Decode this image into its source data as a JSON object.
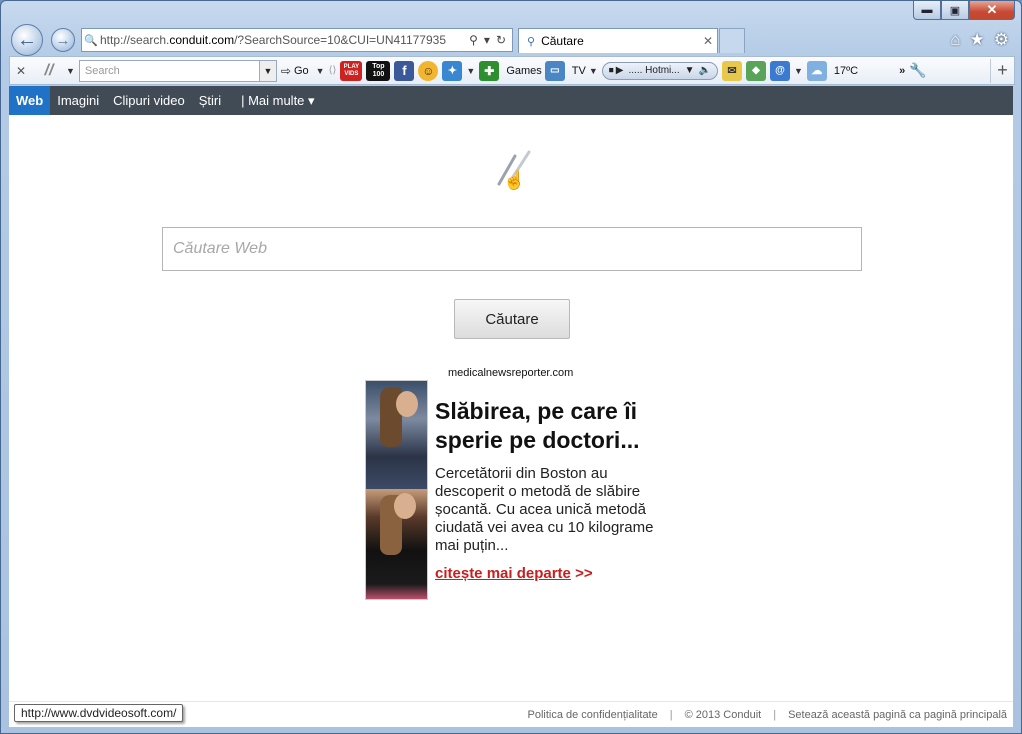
{
  "browser": {
    "address_url_prefix": "http://search.",
    "address_url_domain": "conduit.com",
    "address_url_suffix": "/?SearchSource=10&CUI=UN41177935",
    "tab_title": "Căutare",
    "tab_close": "✕",
    "caption": {
      "minimize": "▬",
      "maximize": "▣",
      "close": "✕"
    }
  },
  "toolbar": {
    "search_placeholder": "Search",
    "go_label": "Go",
    "play_vids_label": "PLAY VIDS",
    "top100_label": "Top 100",
    "games_label": "Games",
    "tv_label": "TV",
    "radio_label": "..... Hotmi...",
    "weather_label": "17ºC"
  },
  "conduit_nav": {
    "items": [
      "Web",
      "Imagini",
      "Clipuri video",
      "Știri",
      "| Mai multe ▾"
    ]
  },
  "search": {
    "placeholder": "Căutare Web",
    "button_label": "Căutare"
  },
  "ad": {
    "domain": "medicalnewsreporter.com",
    "title": "Slăbirea, pe care îi sperie pe doctori...",
    "body": "Cercetătorii din Boston au descoperit o metodă de slăbire șocantă. Cu acea unică metodă ciudată vei avea cu 10 kilograme mai puțin...",
    "link_text": "citește mai departe",
    "link_suffix": ">>"
  },
  "footer": {
    "privacy": "Politica de confidențialitate",
    "copyright": "© 2013 Conduit",
    "set_home": "Setează această pagină ca pagină principală"
  },
  "status_tooltip": "http://www.dvdvideosoft.com/",
  "colors": {
    "nav_active": "#1f72c6",
    "nav_bg": "#404b55",
    "ad_link": "#c81e1e"
  }
}
